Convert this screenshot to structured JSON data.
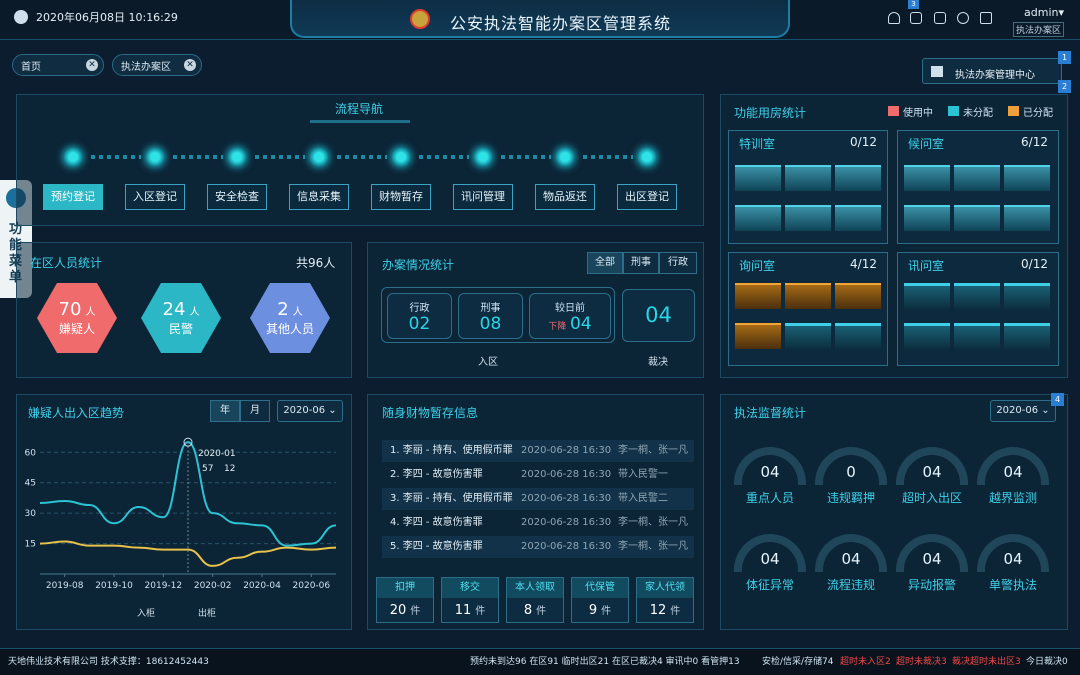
{
  "header": {
    "datetime": "2020年06月08日 10:16:29",
    "title": "公安执法智能办案区管理系统",
    "user": "admin▾",
    "user_area": "执法办案区",
    "badge": "3"
  },
  "tabs": [
    {
      "label": "首页"
    },
    {
      "label": "执法办案区"
    }
  ],
  "mgmt_center": {
    "label": "执法办案管理中心",
    "badge1": "1",
    "badge2": "2"
  },
  "side_menu": {
    "label": "功能菜单"
  },
  "flow": {
    "title": "流程导航",
    "steps": [
      "预约登记",
      "入区登记",
      "安全检查",
      "信息采集",
      "财物暂存",
      "讯问管理",
      "物品返还",
      "出区登记"
    ]
  },
  "people": {
    "title": "在区人员统计",
    "total": "共96人",
    "items": [
      {
        "num": "70",
        "unit": "人",
        "label": "嫌疑人"
      },
      {
        "num": "24",
        "unit": "人",
        "label": "民警"
      },
      {
        "num": "2",
        "unit": "人",
        "label": "其他人员"
      }
    ]
  },
  "cases": {
    "title": "办案情况统计",
    "filters": [
      "全部",
      "刑事",
      "行政"
    ],
    "items": [
      {
        "label": "行政",
        "value": "02"
      },
      {
        "label": "刑事",
        "value": "08"
      },
      {
        "label": "较日前",
        "prefix": "下降",
        "value": "04"
      }
    ],
    "group1": "入区",
    "ruling_value": "04",
    "ruling_label": "裁决"
  },
  "rooms": {
    "title": "功能用房统计",
    "legend": [
      {
        "label": "使用中",
        "color": "#f06b6b"
      },
      {
        "label": "未分配",
        "color": "#2bc3d3"
      },
      {
        "label": "已分配",
        "color": "#f0a03a"
      }
    ],
    "blocks": [
      {
        "name": "特训室",
        "count": "0/12"
      },
      {
        "name": "候问室",
        "count": "6/12"
      },
      {
        "name": "询问室",
        "count": "4/12"
      },
      {
        "name": "讯问室",
        "count": "0/12"
      }
    ]
  },
  "trend": {
    "title": "嫌疑人出入区趋势",
    "tabs": [
      "年",
      "月"
    ],
    "period": "2020-06",
    "legend": [
      "入柜",
      "出柜"
    ],
    "chart_data": {
      "type": "line",
      "x": [
        "2019-07",
        "2019-08",
        "2019-09",
        "2019-10",
        "2019-11",
        "2019-12",
        "2020-01",
        "2020-02",
        "2020-03",
        "2020-04",
        "2020-05",
        "2020-06",
        "2020-07"
      ],
      "xticks": [
        "2019-08",
        "2019-10",
        "2019-12",
        "2020-02",
        "2020-04",
        "2020-06"
      ],
      "yticks": [
        "15",
        "30",
        "45",
        "60"
      ],
      "ylim": [
        0,
        70
      ],
      "series": [
        {
          "name": "入柜",
          "color": "#2bc3d3",
          "values": [
            35,
            36,
            34,
            25,
            33,
            28,
            65,
            30,
            25,
            24,
            14,
            15,
            24
          ]
        },
        {
          "name": "出柜",
          "color": "#e8c24a",
          "values": [
            15,
            16,
            14,
            14,
            13,
            12,
            12,
            4,
            8,
            11,
            13,
            12,
            13
          ]
        }
      ],
      "tooltip": {
        "label": "2020-01",
        "v1": "57",
        "v2": "12"
      }
    }
  },
  "property": {
    "title": "随身财物暂存信息",
    "rows": [
      {
        "name": "1. 李丽 - 持有、使用假币罪",
        "time": "2020-06-28 16:30",
        "who": "李一桐、张一凡"
      },
      {
        "name": "2. 李四 - 故意伤害罪",
        "time": "2020-06-28 16:30",
        "who": "带入民警一"
      },
      {
        "name": "3. 李丽 - 持有、使用假币罪",
        "time": "2020-06-28 16:30",
        "who": "带入民警二"
      },
      {
        "name": "4. 李四 - 故意伤害罪",
        "time": "2020-06-28 16:30",
        "who": "李一桐、张一凡"
      },
      {
        "name": "5. 李四 - 故意伤害罪",
        "time": "2020-06-28 16:30",
        "who": "李一桐、张一凡"
      }
    ],
    "stats": [
      {
        "label": "扣押",
        "value": "20",
        "unit": "件"
      },
      {
        "label": "移交",
        "value": "11",
        "unit": "件"
      },
      {
        "label": "本人领取",
        "value": "8",
        "unit": "件"
      },
      {
        "label": "代保管",
        "value": "9",
        "unit": "件"
      },
      {
        "label": "家人代领",
        "value": "12",
        "unit": "件"
      }
    ]
  },
  "supervise": {
    "title": "执法监督统计",
    "period": "2020-06",
    "badge": "4",
    "items": [
      {
        "value": "04",
        "label": "重点人员"
      },
      {
        "value": "0",
        "label": "违规羁押"
      },
      {
        "value": "04",
        "label": "超时入出区"
      },
      {
        "value": "04",
        "label": "越界监测"
      },
      {
        "value": "04",
        "label": "体征异常"
      },
      {
        "value": "04",
        "label": "流程违规"
      },
      {
        "value": "04",
        "label": "异动报警"
      },
      {
        "value": "04",
        "label": "单警执法"
      }
    ]
  },
  "footer": {
    "company": "天地伟业技术有限公司 技术支撑：18612452443",
    "stats": "预约未到达96 在区91 临时出区21 在区已裁决4 审讯中0 看管押13",
    "stats2": "安检/信采/存储74",
    "alerts": [
      "超时未入区2",
      "超时未裁决3",
      "裁决超时未出区3"
    ],
    "today": "今日裁决0"
  }
}
